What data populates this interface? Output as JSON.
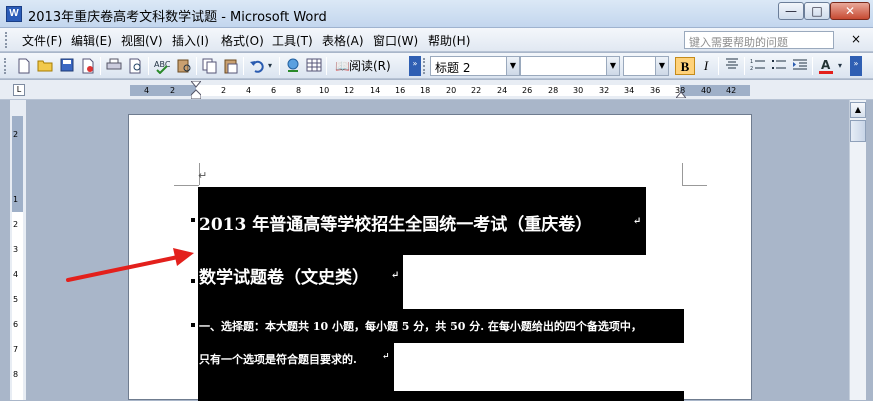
{
  "window": {
    "title": "2013年重庆卷高考文科数学试题 - Microsoft Word",
    "app_icon_letter": "W",
    "min_glyph": "—",
    "max_glyph": "□",
    "close_glyph": "✕"
  },
  "menu": {
    "items": [
      "文件(F)",
      "编辑(E)",
      "视图(V)",
      "插入(I)",
      "格式(O)",
      "工具(T)",
      "表格(A)",
      "窗口(W)",
      "帮助(H)"
    ],
    "help_placeholder": "键入需要帮助的问题",
    "close_glyph": "×"
  },
  "toolbar": {
    "read_label": "阅读(R)",
    "style_value": "标题 2",
    "bold_label": "B",
    "italic_label": "I",
    "icons": [
      "new-doc-icon",
      "open-icon",
      "save-icon",
      "permission-icon",
      "print-icon",
      "print-preview-icon",
      "spelling-icon",
      "research-icon",
      "copy-icon",
      "paste-icon",
      "undo-icon",
      "hyperlink-icon",
      "table-icon",
      "read-icon",
      "align-icon",
      "numbering-icon",
      "bullets-icon",
      "indent-icon",
      "font-color-icon"
    ]
  },
  "ruler": {
    "corner_label": "L",
    "numbers": [
      "4",
      "2",
      "2",
      "4",
      "6",
      "8",
      "10",
      "12",
      "14",
      "16",
      "18",
      "20",
      "22",
      "24",
      "26",
      "28",
      "30",
      "32",
      "34",
      "36",
      "38",
      "40",
      "42"
    ],
    "vertical_numbers": [
      "2",
      "1",
      "2",
      "3",
      "4",
      "5",
      "6",
      "7",
      "8"
    ]
  },
  "document": {
    "heading1": "2013 年普通高等学校招生全国统一考试（重庆卷）",
    "heading2": "数学试题卷（文史类）",
    "para_line1": "一、选择题：本大题共 10 小题，每小题 5 分，共 50 分. 在每小题给出的四个备选项中，",
    "para_line2": "只有一个选项是符合题目要求的.",
    "return_mark": "↵"
  },
  "colors": {
    "annotation_arrow": "#e3201c",
    "selection": "#000000"
  }
}
